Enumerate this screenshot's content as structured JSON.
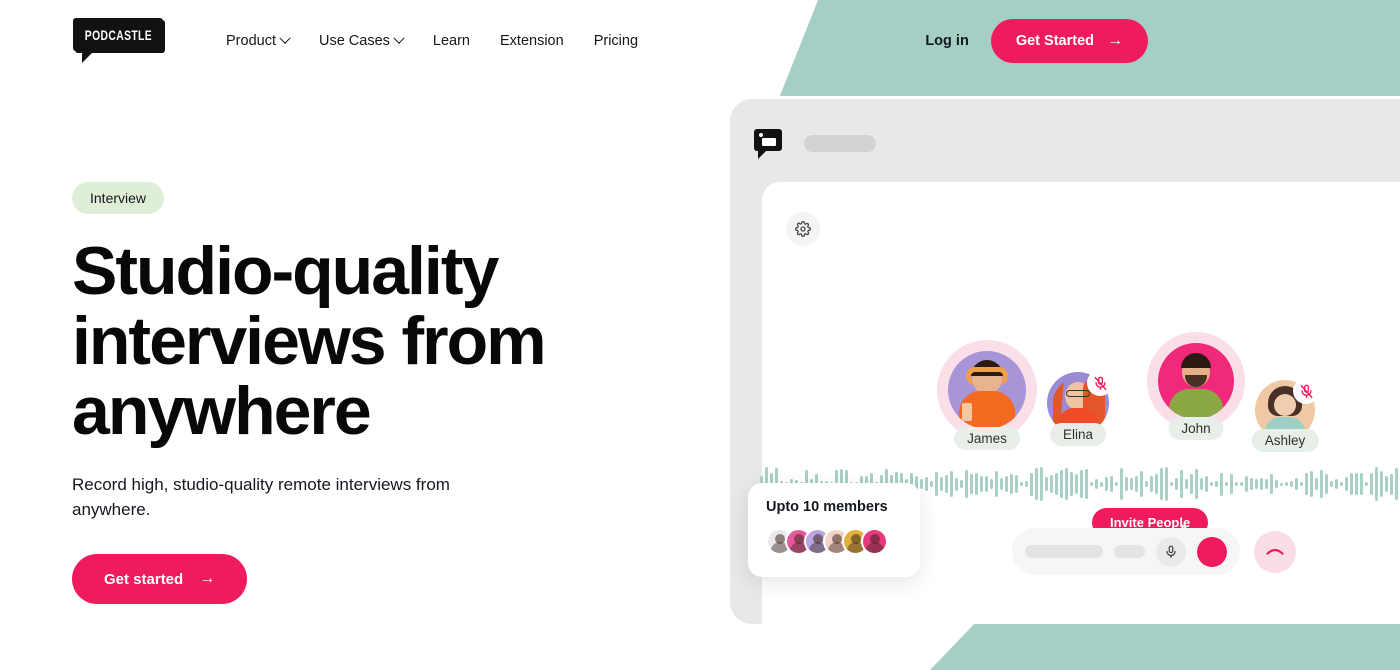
{
  "brand": {
    "logo_text": "PODCASTLE",
    "accent_pink": "#ef1b5c",
    "accent_teal": "#a5cfc6",
    "badge_green": "#dfefd7"
  },
  "nav": {
    "items": [
      {
        "label": "Product",
        "has_caret": true
      },
      {
        "label": "Use Cases",
        "has_caret": true
      },
      {
        "label": "Learn",
        "has_caret": false
      },
      {
        "label": "Extension",
        "has_caret": false
      },
      {
        "label": "Pricing",
        "has_caret": false
      }
    ],
    "login_label": "Log in",
    "cta_label": "Get Started",
    "cta_arrow": "→"
  },
  "hero": {
    "badge": "Interview",
    "title": "Studio-quality interviews from anywhere",
    "subtitle": "Record high, studio-quality remote interviews from anywhere.",
    "cta_label": "Get started",
    "cta_arrow": "→"
  },
  "app": {
    "titlebar_placeholder": "",
    "settings_icon": "gear-icon",
    "participants": [
      {
        "name": "James",
        "muted": false,
        "ring": "#fbdfe8",
        "photo_bg": "#a795d8",
        "shirt": "#f2691f",
        "skin": "#e8b48f",
        "hair": "#2a1b12"
      },
      {
        "name": "Elina",
        "muted": true,
        "ring": "#fbdfe8",
        "photo_bg": "#9b8ad4",
        "shirt": "#ef4b26",
        "skin": "#f0c3a2",
        "hair": "#e3562a"
      },
      {
        "name": "John",
        "muted": false,
        "ring": "#fbdfe8",
        "photo_bg": "#f0297b",
        "shirt": "#8aa843",
        "skin": "#e6b189",
        "hair": "#2b1a14"
      },
      {
        "name": "Ashley",
        "muted": true,
        "ring": "#fbdfe8",
        "photo_bg": "#efc9a6",
        "shirt": "#9ecfc4",
        "skin": "#f0cdae",
        "hair": "#4a3026"
      }
    ],
    "invite_label": "Invite People",
    "cursor_color": "#a6e24b",
    "members_card": {
      "title": "Upto 10 members",
      "avatar_count": 6,
      "avatar_colors": [
        "#e9e9ec",
        "#e8599c",
        "#bba4e0",
        "#f3d3c6",
        "#e0b13f",
        "#e8397f"
      ]
    },
    "controls": {
      "mic_icon": "microphone-icon",
      "record_icon": "record-button",
      "end_call_icon": "hang-up-icon"
    },
    "waveform": {
      "color": "#a8d0c6",
      "bar_count": 160
    }
  }
}
